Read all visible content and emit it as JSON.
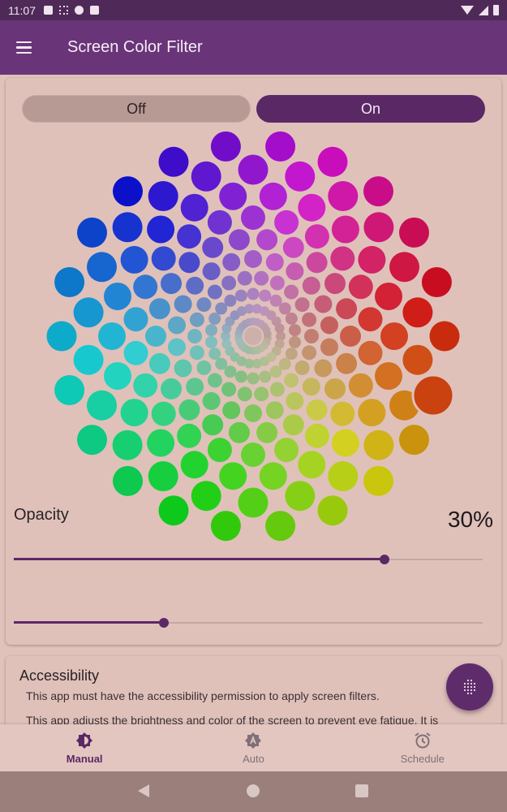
{
  "status_bar": {
    "time": "11:07",
    "icons": [
      "a-icon",
      "dots-icon",
      "p-icon",
      "sd-icon",
      "wifi-icon",
      "signal-icon",
      "battery-icon"
    ]
  },
  "app_bar": {
    "title": "Screen Color Filter",
    "menu_icon": "hamburger-icon"
  },
  "toggle": {
    "off_label": "Off",
    "on_label": "On",
    "selected": "On"
  },
  "color_slider": {
    "value_fraction": 0.79
  },
  "opacity": {
    "label": "Opacity",
    "value": "30%",
    "value_fraction": 0.32
  },
  "accessibility": {
    "title": "Accessibility",
    "text1": "This app must have the accessibility permission to apply screen filters.",
    "text2": "This app adjusts the brightness and color of the screen to prevent eye fatigue. It is"
  },
  "fab": {
    "icon": "dot-grid-icon"
  },
  "bottom_nav": {
    "items": [
      {
        "label": "Manual",
        "icon": "brightness-icon",
        "active": true
      },
      {
        "label": "Auto",
        "icon": "auto-brightness-icon",
        "active": false
      },
      {
        "label": "Schedule",
        "icon": "alarm-clock-icon",
        "active": false
      }
    ]
  },
  "colors": {
    "app_bar": "#6a3479",
    "status_bar": "#4f2a58",
    "accent": "#5b2866",
    "background": "#e0c2bb"
  }
}
